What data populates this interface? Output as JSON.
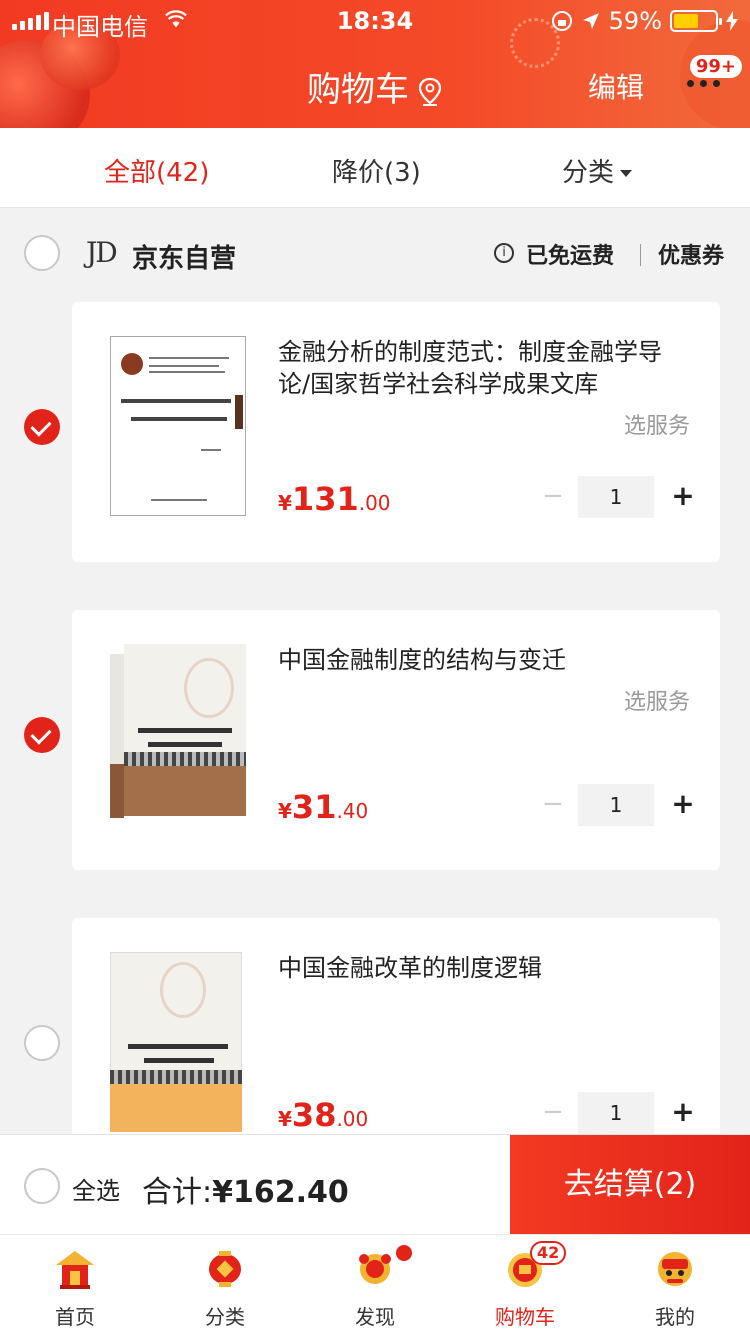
{
  "status": {
    "carrier": "中国电信",
    "time": "18:34",
    "battery": "59%",
    "battery_level": 0.59
  },
  "nav": {
    "title": "购物车",
    "edit": "编辑",
    "msg_badge": "99+"
  },
  "tabs": {
    "all": "全部(42)",
    "price_drop": "降价(3)",
    "category": "分类"
  },
  "store": {
    "logo": "JD",
    "name": "京东自营",
    "free_shipping": "已免运费",
    "coupon": "优惠券",
    "info_glyph": "i"
  },
  "items": [
    {
      "title": "金融分析的制度范式：制度金融学导论/国家哲学社会科学成果文库",
      "service": "选服务",
      "price_int": "131",
      "price_dec": ".00",
      "qty": "1",
      "checked": true
    },
    {
      "title": "中国金融制度的结构与变迁",
      "service": "选服务",
      "price_int": "31",
      "price_dec": ".40",
      "qty": "1",
      "checked": true
    },
    {
      "title": "中国金融改革的制度逻辑",
      "price_int": "38",
      "price_dec": ".00",
      "qty": "1",
      "checked": false
    }
  ],
  "currency": "¥",
  "minus": "−",
  "plus": "+",
  "checkout": {
    "select_all": "全选",
    "total_label": "合计:",
    "total_value": "¥162.40",
    "button": "去结算(2)"
  },
  "tabbar": {
    "items": [
      {
        "label": "首页",
        "icon": "home-icon"
      },
      {
        "label": "分类",
        "icon": "category-icon"
      },
      {
        "label": "发现",
        "icon": "discover-icon"
      },
      {
        "label": "购物车",
        "icon": "cart-icon"
      },
      {
        "label": "我的",
        "icon": "profile-icon"
      }
    ],
    "cart_badge": "42"
  },
  "colors": {
    "brand_red": "#e2231a",
    "header_gradient_start": "#f23a22"
  }
}
